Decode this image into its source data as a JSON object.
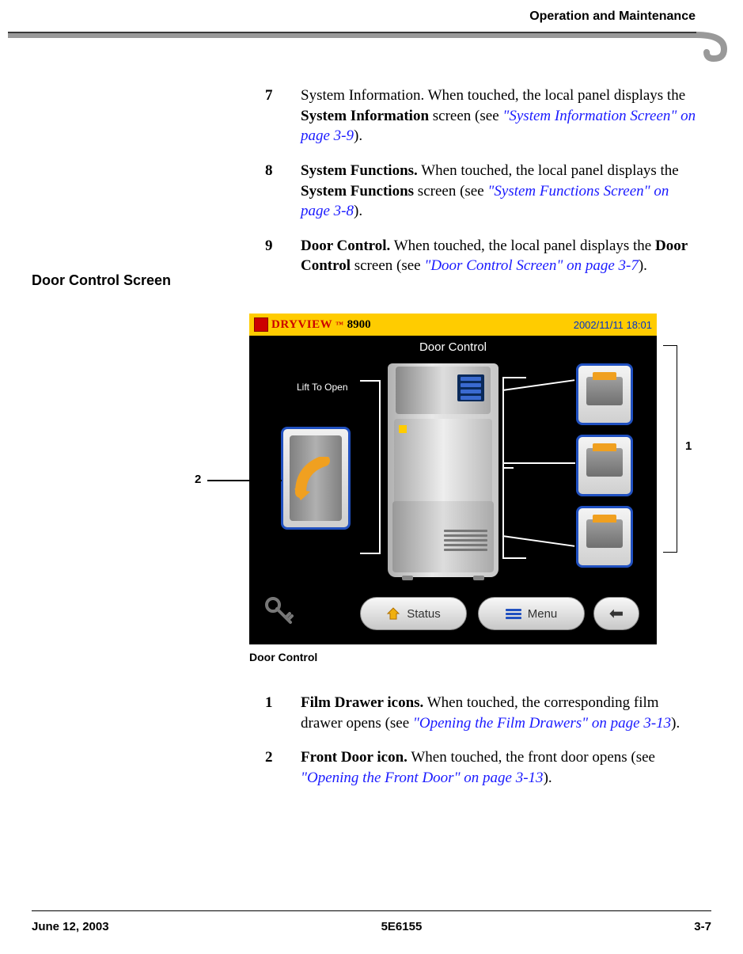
{
  "header": {
    "title": "Operation and Maintenance"
  },
  "top_list": [
    {
      "num": "7",
      "lead": "",
      "body_pre": "System Information. When touched, the local panel displays the ",
      "bold1": "System Information",
      "body_mid": " screen (see ",
      "link": "\"System Information Screen\" on page 3-9",
      "body_end": ")."
    },
    {
      "num": "8",
      "lead": "System Functions.",
      "body_pre": " When touched, the local panel displays the ",
      "bold1": "System Functions",
      "body_mid": " screen (see ",
      "link": "\"System Functions Screen\" on page 3-8",
      "body_end": ")."
    },
    {
      "num": "9",
      "lead": "Door Control.",
      "body_pre": " When touched, the local panel displays the ",
      "bold1": "Door Control",
      "body_mid": " screen (see ",
      "link": "\"Door Control Screen\" on page 3-7",
      "body_end": ")."
    }
  ],
  "section_heading": "Door Control Screen",
  "screenshot": {
    "brand_main": "DRYVIEW",
    "brand_tm": "™",
    "brand_model": "8900",
    "timestamp": "2002/11/11 18:01",
    "title": "Door Control",
    "lift_label": "Lift To Open",
    "status_btn": "Status",
    "menu_btn": "Menu",
    "back_glyph": "⬅"
  },
  "callouts": {
    "one": "1",
    "two": "2"
  },
  "figure_caption": "Door Control",
  "lower_list": [
    {
      "num": "1",
      "lead": "Film Drawer icons.",
      "body_pre": " When touched, the corresponding film drawer opens (see ",
      "link": "\"Opening the Film Drawers\" on page 3-13",
      "body_end": ")."
    },
    {
      "num": "2",
      "lead": "Front Door icon.",
      "body_pre": " When touched, the front door opens (see ",
      "link": "\"Opening the Front Door\" on page 3-13",
      "body_end": ")."
    }
  ],
  "footer": {
    "left": "June 12, 2003",
    "center": "5E6155",
    "right": "3-7"
  }
}
